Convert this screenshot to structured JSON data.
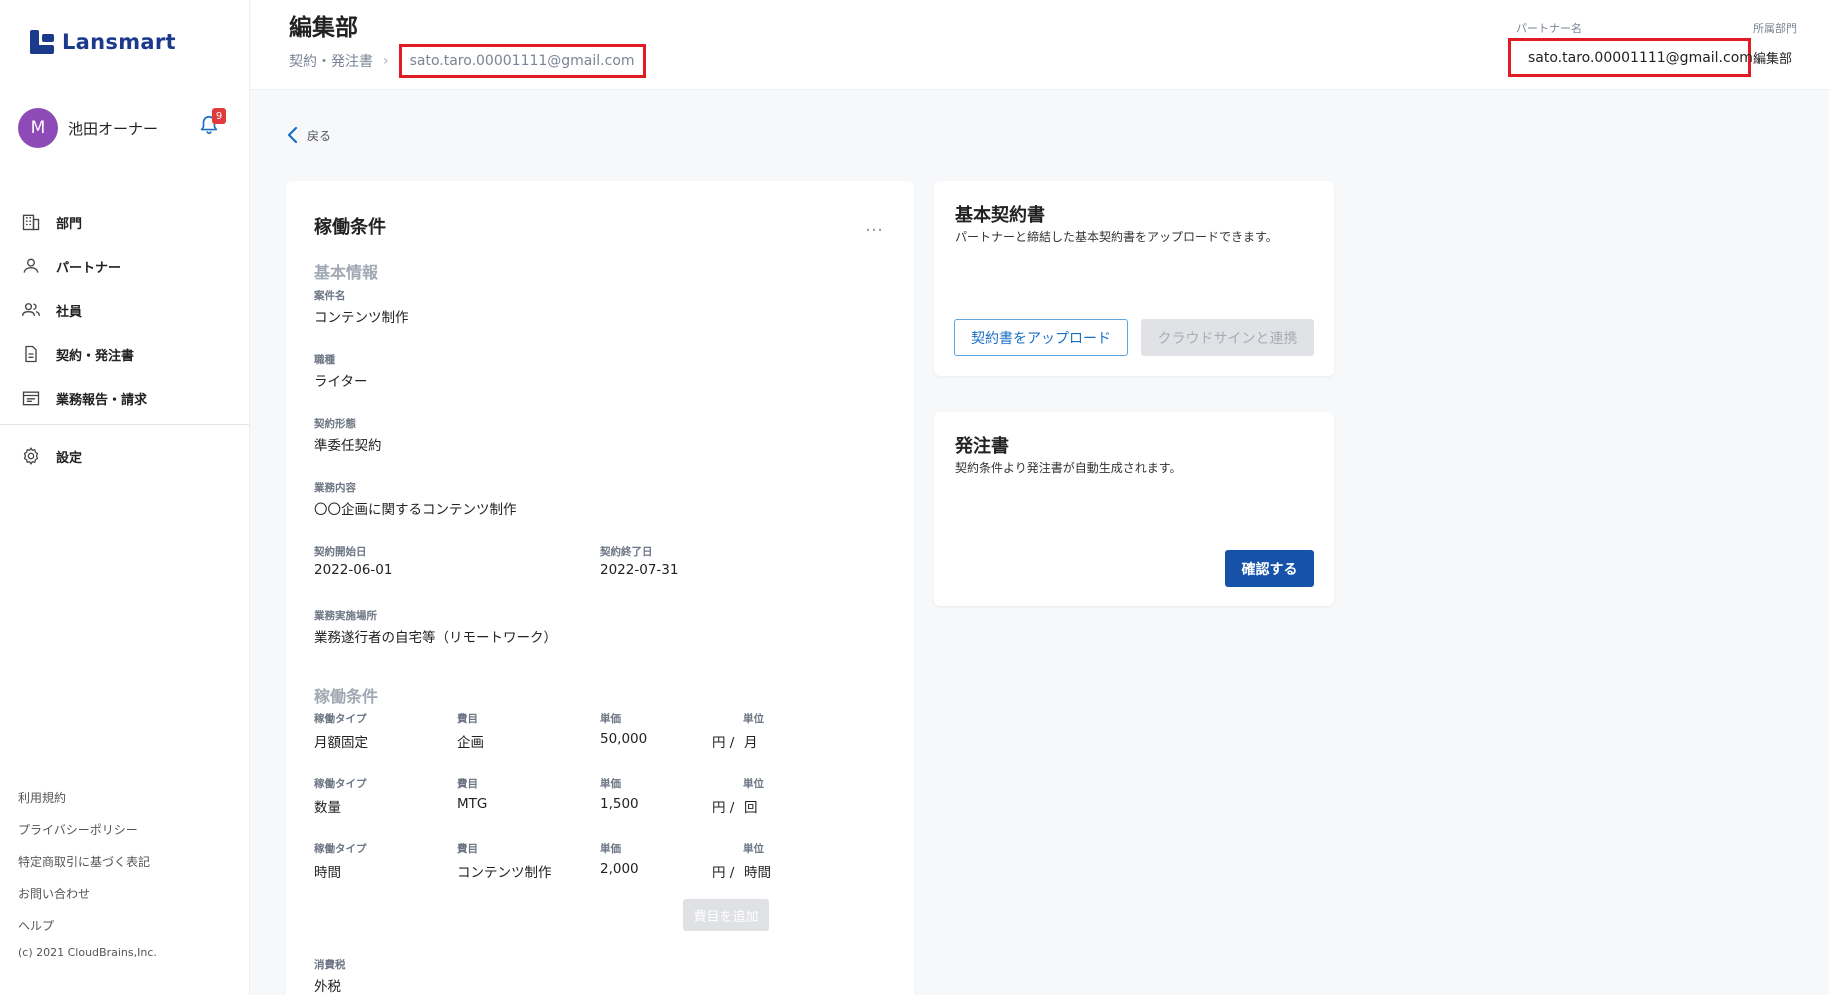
{
  "app": {
    "logo_text": "Lansmart"
  },
  "user": {
    "initial": "M",
    "name": "池田オーナー",
    "notification_count": "9"
  },
  "sidebar": {
    "items": [
      {
        "label": "部門",
        "icon": "building-icon"
      },
      {
        "label": "パートナー",
        "icon": "person-icon"
      },
      {
        "label": "社員",
        "icon": "people-icon"
      },
      {
        "label": "契約・発注書",
        "icon": "document-icon"
      },
      {
        "label": "業務報告・請求",
        "icon": "report-icon"
      }
    ],
    "settings_label": "設定",
    "footer_links": [
      "利用規約",
      "プライバシーポリシー",
      "特定商取引に基づく表記",
      "お問い合わせ",
      "ヘルプ"
    ],
    "copyright": "(c) 2021 CloudBrains,Inc."
  },
  "header": {
    "title": "編集部",
    "breadcrumb_parent": "契約・発注書",
    "breadcrumb_current": "sato.taro.00001111@gmail.com",
    "partner_label": "パートナー名",
    "partner_value": "sato.taro.00001111@gmail.com",
    "dept_label": "所属部門",
    "dept_value": "編集部"
  },
  "back_label": "戻る",
  "conditions_card": {
    "title": "稼働条件",
    "more": "…",
    "basic_section": "基本情報",
    "project_name_label": "案件名",
    "project_name": "コンテンツ制作",
    "job_type_label": "職種",
    "job_type": "ライター",
    "contract_type_label": "契約形態",
    "contract_type": "準委任契約",
    "work_content_label": "業務内容",
    "work_content": "〇〇企画に関するコンテンツ制作",
    "start_label": "契約開始日",
    "start_date": "2022-06-01",
    "end_label": "契約終了日",
    "end_date": "2022-07-31",
    "location_label": "業務実施場所",
    "location": "業務遂行者の自宅等（リモートワーク）",
    "work_section": "稼働条件",
    "rate_headers": {
      "type": "稼働タイプ",
      "item": "費目",
      "price": "単価",
      "unit": "単位"
    },
    "rates": [
      {
        "type": "月額固定",
        "item": "企画",
        "price": "50,000",
        "yen": "円 /",
        "unit": "月"
      },
      {
        "type": "数量",
        "item": "MTG",
        "price": "1,500",
        "yen": "円 /",
        "unit": "回"
      },
      {
        "type": "時間",
        "item": "コンテンツ制作",
        "price": "2,000",
        "yen": "円 /",
        "unit": "時間"
      }
    ],
    "add_item_label": "費目を追加",
    "tax_label": "消費税",
    "tax_value": "外税"
  },
  "basic_contract_card": {
    "title": "基本契約書",
    "description": "パートナーと締結した基本契約書をアップロードできます。",
    "upload_label": "契約書をアップロード",
    "cloudsign_label": "クラウドサインと連携"
  },
  "order_card": {
    "title": "発注書",
    "description": "契約条件より発注書が自動生成されます。",
    "confirm_label": "確認する"
  }
}
